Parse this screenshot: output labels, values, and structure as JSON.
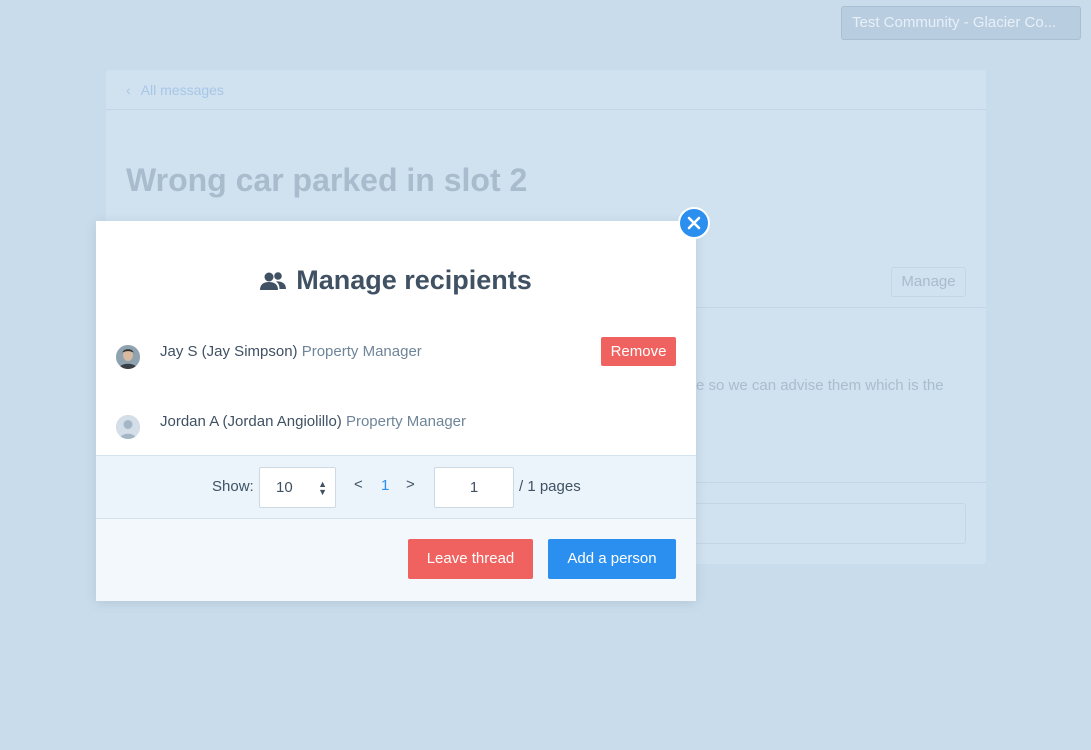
{
  "header": {
    "community": "Test Community - Glacier Co..."
  },
  "background": {
    "breadcrumb": "All messages",
    "thread_title": "Wrong car parked in slot 2",
    "manage_label": "Manage",
    "message_excerpt": "re so we can advise them which is the"
  },
  "modal": {
    "title": "Manage recipients",
    "icon": "users-icon",
    "recipients": [
      {
        "name": "Jay S (Jay Simpson)",
        "role": "Property Manager",
        "action": "Remove"
      },
      {
        "name": "Jordan A (Jordan Angiolillo)",
        "role": "Property Manager"
      }
    ],
    "pagination": {
      "show_label": "Show:",
      "show_value": "10",
      "prev": "<",
      "current_page": "1",
      "next": ">",
      "page_input": "1",
      "total": "/ 1 pages"
    },
    "leave_label": "Leave thread",
    "add_label": "Add a person"
  },
  "colors": {
    "accent": "#2b8ff0",
    "danger": "#f0625f",
    "overlay": "#c9dceb"
  }
}
